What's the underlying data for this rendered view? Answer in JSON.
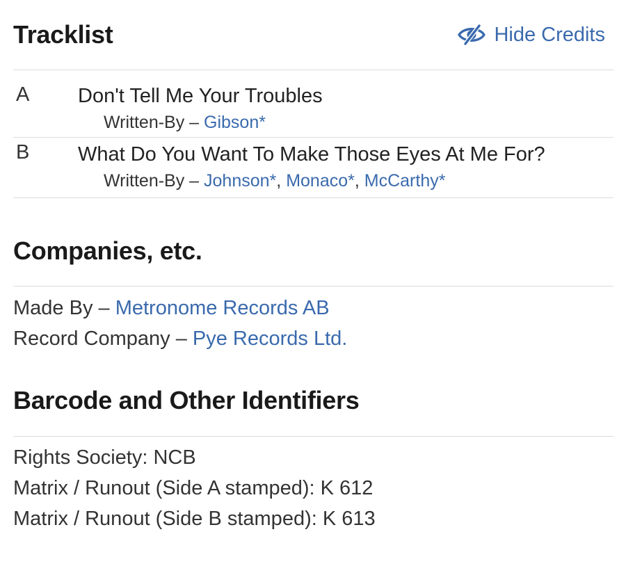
{
  "tracklist": {
    "heading": "Tracklist",
    "hide_credits_label": "Hide Credits",
    "tracks": [
      {
        "position": "A",
        "title": "Don't Tell Me Your Troubles",
        "credit_role": "Written-By",
        "credit_sep": " – ",
        "credits": [
          "Gibson*"
        ]
      },
      {
        "position": "B",
        "title": "What Do You Want To Make Those Eyes At Me For?",
        "credit_role": "Written-By",
        "credit_sep": " – ",
        "credits": [
          "Johnson*",
          "Monaco*",
          "McCarthy*"
        ]
      }
    ]
  },
  "companies": {
    "heading": "Companies, etc.",
    "items": [
      {
        "role": "Made By",
        "sep": " – ",
        "name": "Metronome Records AB"
      },
      {
        "role": "Record Company",
        "sep": " – ",
        "name": "Pye Records Ltd."
      }
    ]
  },
  "identifiers": {
    "heading": "Barcode and Other Identifiers",
    "items": [
      "Rights Society: NCB",
      "Matrix / Runout (Side A stamped): K 612",
      "Matrix / Runout (Side B stamped): K 613"
    ]
  },
  "colors": {
    "link": "#3a6aad",
    "text": "#1f1f1f",
    "divider": "#dcdcdc"
  },
  "icons": {
    "hide_credits": "eye-slash-icon"
  }
}
